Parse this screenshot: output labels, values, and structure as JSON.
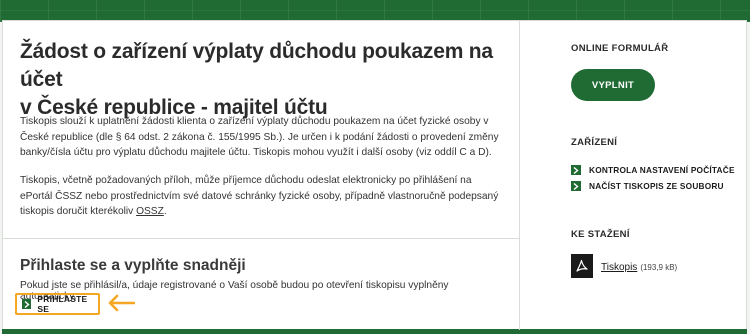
{
  "main": {
    "title_line1": "Žádost o zařízení výplaty důchodu poukazem na účet",
    "title_line2": "v České republice - majitel účtu",
    "paragraph1": "Tiskopis slouží k uplatnění žádosti klienta o zařízení výplaty důchodu poukazem na účet fyzické osoby v České republice (dle § 64 odst. 2 zákona č. 155/1995 Sb.). Je určen i k podání žádosti o provedení změny banky/čísla účtu pro výplatu důchodu majitele účtu. Tiskopis mohou využít i další osoby (viz oddíl C a D).",
    "paragraph2_text": "Tiskopis, včetně požadovaných příloh, může příjemce důchodu odeslat elektronicky po přihlášení na ePortál ČSSZ nebo prostřednictvím své datové schránky fyzické osoby, případně vlastnoručně podepsaný tiskopis doručit kterékoliv ",
    "paragraph2_link": "OSSZ",
    "paragraph2_end": "."
  },
  "login": {
    "title": "Přihlaste se a vyplňte snadněji",
    "text": "Pokud jste se přihlásil/a, údaje registrované o Vaší osobě budou po otevření tiskopisu vyplněny automaticky.",
    "button_label": "PŘIHLASTE SE"
  },
  "sidebar": {
    "online_heading": "ONLINE FORMULÁŘ",
    "fill_button": "VYPLNIT",
    "device_heading": "ZAŘÍZENÍ",
    "links": [
      {
        "label": "KONTROLA NASTAVENÍ POČÍTAČE"
      },
      {
        "label": "NAČÍST TISKOPIS ZE SOUBORU"
      }
    ],
    "download_heading": "KE STAŽENÍ",
    "download_link": "Tiskopis",
    "download_size": "(193,9 kB)"
  },
  "colors": {
    "brand_green": "#1f6b33",
    "highlight_orange": "#f5a623"
  }
}
